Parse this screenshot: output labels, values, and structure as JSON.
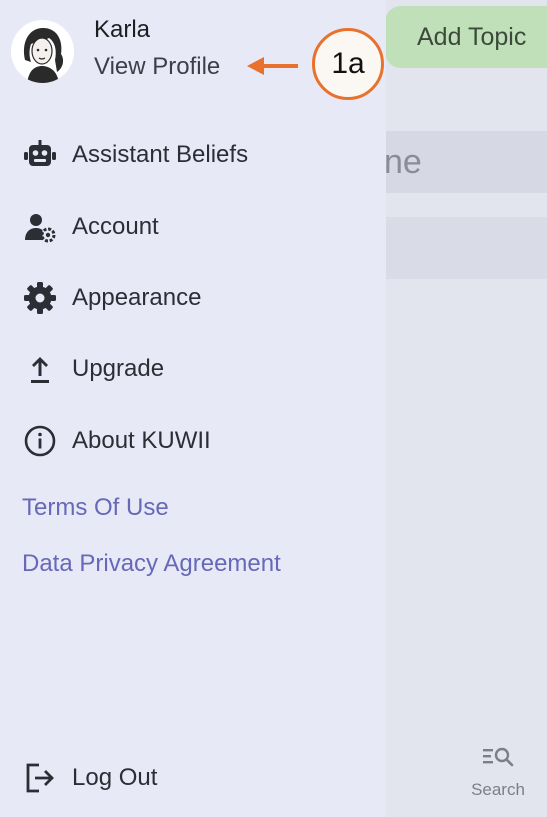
{
  "background": {
    "add_topic_label": "Add Topic",
    "field_text_fragment": "ne",
    "search_label": "Search"
  },
  "drawer": {
    "user": {
      "name": "Karla",
      "view_profile_label": "View Profile"
    },
    "menu": [
      {
        "label": "Assistant Beliefs",
        "icon": "robot-icon"
      },
      {
        "label": "Account",
        "icon": "user-gear-icon"
      },
      {
        "label": "Appearance",
        "icon": "gear-icon"
      },
      {
        "label": "Upgrade",
        "icon": "upload-icon"
      },
      {
        "label": "About KUWII",
        "icon": "info-icon"
      }
    ],
    "links": {
      "terms": "Terms Of Use",
      "privacy": "Data Privacy Agreement"
    },
    "logout_label": "Log Out"
  },
  "annotation": {
    "label": "1a",
    "color": "#e8722d"
  },
  "colors": {
    "drawer_bg": "#e8e9f6",
    "link": "#6768b8",
    "add_topic_bg": "#bfe0b8"
  }
}
